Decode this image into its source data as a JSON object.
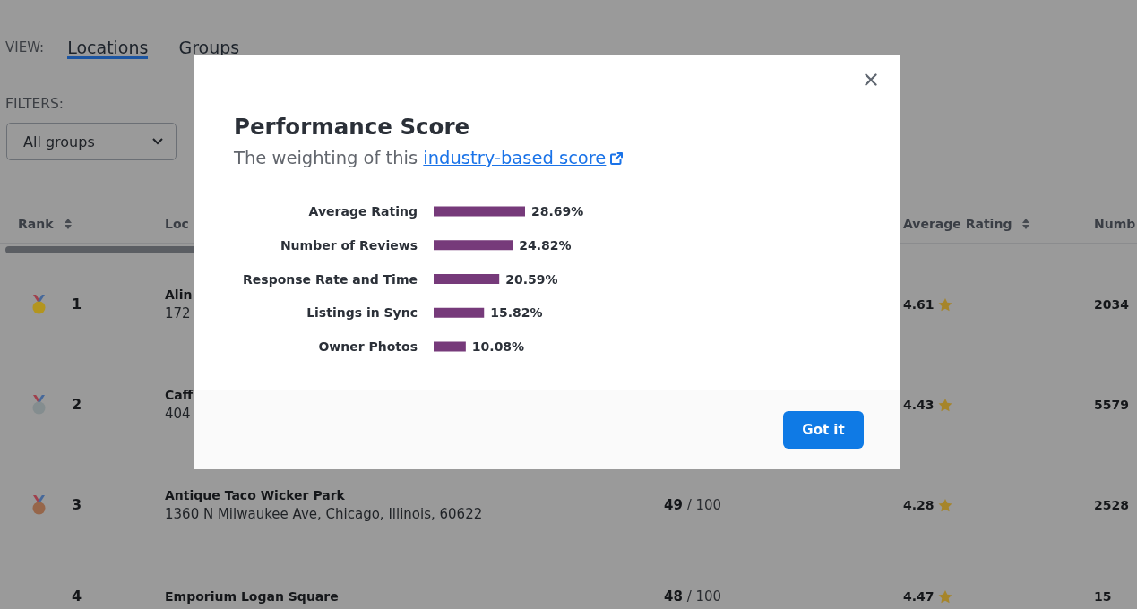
{
  "view": {
    "label": "VIEW:",
    "tabs": [
      {
        "label": "Locations",
        "selected": true
      },
      {
        "label": "Groups",
        "selected": false
      }
    ]
  },
  "filters": {
    "label": "FILTERS:",
    "group_select": {
      "value": "All groups"
    }
  },
  "table": {
    "columns": [
      {
        "kind": "sortable",
        "label": "Rank"
      },
      {
        "kind": "plain",
        "label": "Loc"
      },
      {
        "kind": "sortable",
        "label": "Average Rating"
      },
      {
        "kind": "plain",
        "label": "Numb"
      }
    ],
    "rows": [
      {
        "color": "#b3951f",
        "rank": "1",
        "name": "Alin",
        "address": "172",
        "rating": "4.61",
        "count": "2034"
      },
      {
        "color": "#848d8f",
        "rank": "2",
        "name": "Caff",
        "address": "404",
        "rating": "4.43",
        "count": "5579"
      },
      {
        "color": "#96664a",
        "rank": "3",
        "name": "Antique Taco Wicker Park",
        "address": "1360 N Milwaukee Ave, Chicago, Illinois, 60622",
        "score": "**49** / 100",
        "rating": "4.28",
        "count": "2528"
      },
      {
        "rank": "4",
        "name": "Emporium Logan Square",
        "score": "**48** / 100",
        "rating": "4.47",
        "count": "15"
      }
    ]
  },
  "modal": {
    "title": "Performance Score",
    "subtitle": "The weighting of this",
    "link": "industry-based score",
    "chart_data": [
      {
        "type": "bar",
        "orientation": "horizontal",
        "categories": [
          "Average Rating",
          "Number of Reviews",
          "Response Rate and Time",
          "Listings in Sync",
          "Owner Photos"
        ],
        "values": [
          28.69,
          24.82,
          20.59,
          15.82,
          10.08
        ],
        "value_labels": [
          "28.69%",
          "24.82%",
          "20.59%",
          "15.82%",
          "10.08%"
        ],
        "color": "#763a7a"
      }
    ],
    "button": "Got it"
  }
}
